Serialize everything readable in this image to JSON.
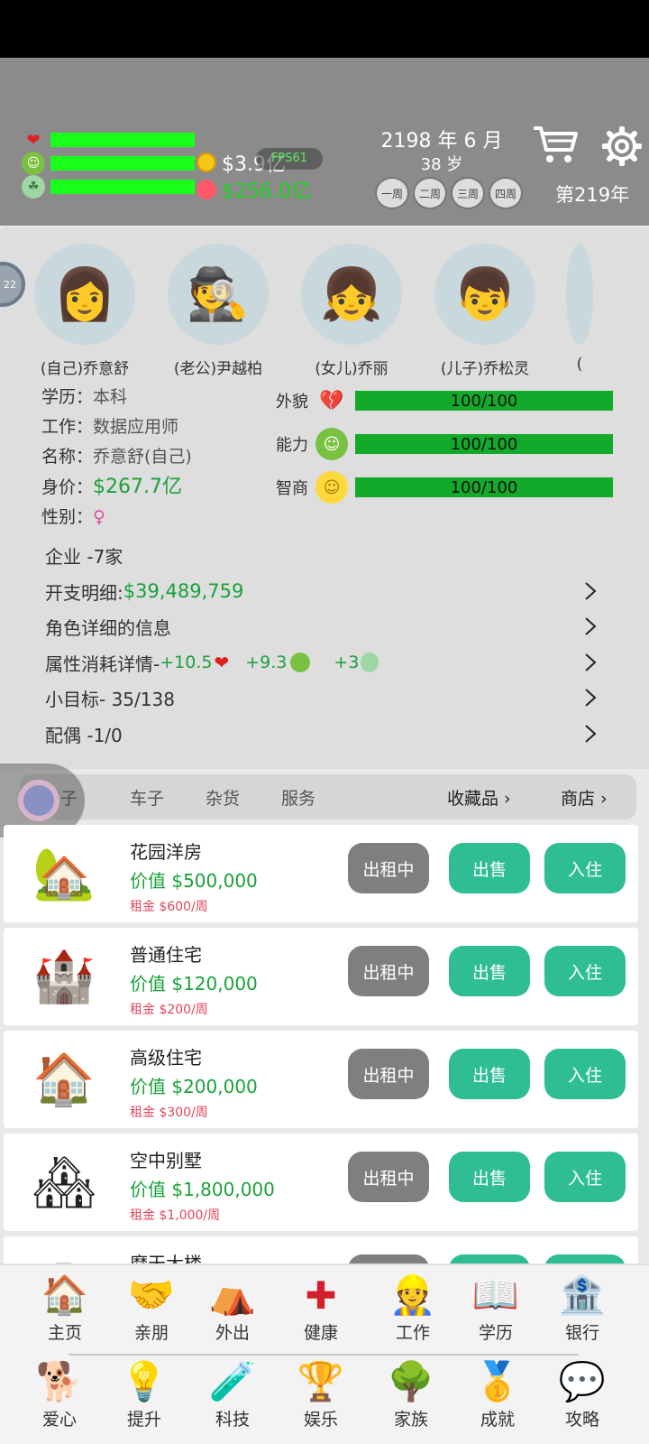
{
  "header": {
    "money_cash": "$3.9亿",
    "money_worth": "$256.0亿",
    "fps": "FPS61",
    "date": "2198 年 6 月",
    "age": "38 岁",
    "weeks": [
      "一周",
      "二周",
      "三周",
      "四周"
    ],
    "year": "第219年",
    "icons": [
      "heart-icon",
      "face-icon",
      "brain-icon",
      "coin-icon",
      "cart-icon",
      "gear-icon"
    ]
  },
  "family": {
    "badge": "22",
    "members": [
      {
        "name": "(自己)乔意舒",
        "icon": "woman-avatar"
      },
      {
        "name": "(老公)尹越柏",
        "icon": "man-hat-avatar"
      },
      {
        "name": "(女儿)乔丽",
        "icon": "girl-avatar"
      },
      {
        "name": "(儿子)乔松灵",
        "icon": "boy-glasses-avatar"
      },
      {
        "name": "(",
        "icon": "avatar"
      }
    ]
  },
  "profile": {
    "edu_label": "学历：",
    "edu": "本科",
    "job_label": "工作：",
    "job": "数据应用师",
    "name_label": "名称：",
    "name": "乔意舒(自己)",
    "worth_label": "身价：",
    "worth": "$267.7亿",
    "gender_label": "性别：",
    "gender": "♀"
  },
  "attributes": [
    {
      "label": "外貌",
      "value": "100/100",
      "fraction": 1.0,
      "icon": "broken-heart-icon"
    },
    {
      "label": "能力",
      "value": "100/100",
      "fraction": 1.0,
      "icon": "green-face-icon"
    },
    {
      "label": "智商",
      "value": "100/100",
      "fraction": 1.0,
      "icon": "smile-face-icon"
    }
  ],
  "details": {
    "company": "企业 -7家",
    "expense_label": "开支明细: ",
    "expense_value": "$39,489,759",
    "character": "角色详细的信息",
    "consume_label": "属性消耗详情-",
    "consume_a": "+10.5",
    "consume_b": "+9.3",
    "consume_c": "+3",
    "goal": "小目标- 35/138",
    "spouse": "配偶 -1/0"
  },
  "tabs": {
    "house": "房子",
    "car": "车子",
    "goods": "杂货",
    "service": "服务",
    "collection": "收藏品",
    "shop": "商店"
  },
  "properties": [
    {
      "title": "花园洋房",
      "price": "价值 $500,000",
      "rent": "租金 $600/周",
      "icon": "garden-house-icon"
    },
    {
      "title": "普通住宅",
      "price": "价值 $120,000",
      "rent": "租金 $200/周",
      "icon": "castle-icon"
    },
    {
      "title": "高级住宅",
      "price": "价值 $200,000",
      "rent": "租金 $300/周",
      "icon": "red-house-icon"
    },
    {
      "title": "空中别墅",
      "price": "价值 $1,800,000",
      "rent": "租金 $1,000/周",
      "icon": "villa-icon"
    },
    {
      "title": "摩天大楼",
      "price": "",
      "rent": "",
      "icon": "tower-icon"
    }
  ],
  "buttons": {
    "rented": "出租中",
    "sell": "出售",
    "live": "入住"
  },
  "nav": {
    "row1": [
      "主页",
      "亲朋",
      "外出",
      "健康",
      "工作",
      "学历",
      "银行"
    ],
    "row2": [
      "爱心",
      "提升",
      "科技",
      "娱乐",
      "家族",
      "成就",
      "攻略"
    ]
  },
  "colors": {
    "bar_green": "#19ff19",
    "attr_green": "#13a92b",
    "button_teal": "#2fbd94",
    "button_gray": "#7f7f7f",
    "header_gray": "#8b8b8b"
  }
}
